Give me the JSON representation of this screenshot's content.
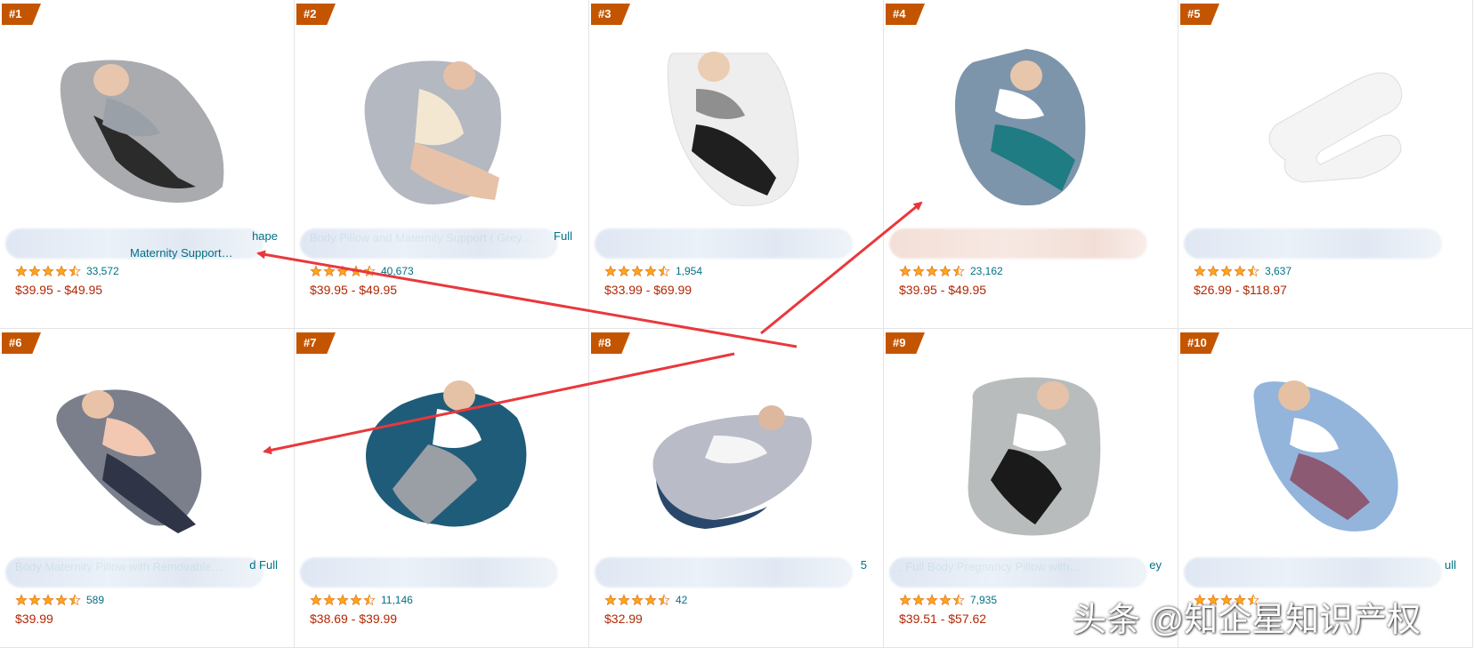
{
  "products": [
    {
      "rank": "#1",
      "title_line1": "",
      "title_line2": "",
      "title_tail_1": "hape",
      "title_tail_2": "Maternity Support…",
      "rating": 4.5,
      "count": "33,572",
      "price": "$39.95 - $49.95",
      "pillow_color": "#a9abae",
      "accent": "#2b2b2b",
      "blur_style": "blue"
    },
    {
      "rank": "#2",
      "title_line1": "",
      "title_line2": "Body Pillow and Maternity Support ( Grey…",
      "title_tail_1": "Full",
      "title_tail_2": "",
      "rating": 4.5,
      "count": "40,673",
      "price": "$39.95 - $49.95",
      "pillow_color": "#b4b8c0",
      "accent": "#f3e7d2",
      "blur_style": "blue"
    },
    {
      "rank": "#3",
      "title_line1": "",
      "title_line2": "",
      "title_tail_1": "",
      "title_tail_2": "",
      "rating": 4.5,
      "count": "1,954",
      "price": "$33.99 - $69.99",
      "pillow_color": "#eeeeee",
      "accent": "#1f1f1f",
      "blur_style": "blue"
    },
    {
      "rank": "#4",
      "title_line1": "",
      "title_line2": "",
      "title_tail_1": "",
      "title_tail_2": "",
      "rating": 4.5,
      "count": "23,162",
      "price": "$39.95 - $49.95",
      "pillow_color": "#7d95ab",
      "accent": "#1e7c82",
      "blur_style": "peach"
    },
    {
      "rank": "#5",
      "title_line1": "",
      "title_line2": "",
      "title_tail_1": "",
      "title_tail_2": "",
      "rating": 4.5,
      "count": "3,637",
      "price": "$26.99 - $118.97",
      "pillow_color": "#f4f4f4",
      "accent": "#e0e0e0",
      "blur_style": "blue"
    },
    {
      "rank": "#6",
      "title_line1": "",
      "title_line2": "Body Maternity Pillow with Removable…",
      "title_tail_1": "d Full",
      "title_tail_2": "",
      "rating": 4.5,
      "count": "589",
      "price": "$39.99",
      "pillow_color": "#7b7f8c",
      "accent": "#2f3447",
      "blur_style": "blue"
    },
    {
      "rank": "#7",
      "title_line1": "",
      "title_line2": "",
      "title_tail_1": "",
      "title_tail_2": "",
      "rating": 4.5,
      "count": "11,146",
      "price": "$38.69 - $39.99",
      "pillow_color": "#1f5c79",
      "accent": "#9a9ea5",
      "blur_style": "blue"
    },
    {
      "rank": "#8",
      "title_line1": "",
      "title_line2": "",
      "title_tail_1": "5",
      "title_tail_2": "",
      "rating": 4.5,
      "count": "42",
      "price": "$32.99",
      "pillow_color": "#b9bcc6",
      "accent": "#29476b",
      "blur_style": "blue"
    },
    {
      "rank": "#9",
      "title_line1": "",
      "title_line2": ", Full Body Pregnancy Pillow with…",
      "title_tail_1": "ey",
      "title_tail_2": "",
      "rating": 4.5,
      "count": "7,935",
      "price": "$39.51 - $57.62",
      "pillow_color": "#b9bcbd",
      "accent": "#1a1a1a",
      "blur_style": "blue"
    },
    {
      "rank": "#10",
      "title_line1": "",
      "title_line2": "",
      "title_tail_1": "ull",
      "title_tail_2": "",
      "rating": 4.5,
      "count": "",
      "price": "",
      "pillow_color": "#93b5dc",
      "accent": "#8c5a73",
      "blur_style": "blue"
    }
  ],
  "watermark": "头条 @知企星知识产权",
  "colors": {
    "badge": "#c45500",
    "link": "#007185",
    "price": "#b12704",
    "star": "#ffa41c",
    "arrow": "#e8383d"
  }
}
